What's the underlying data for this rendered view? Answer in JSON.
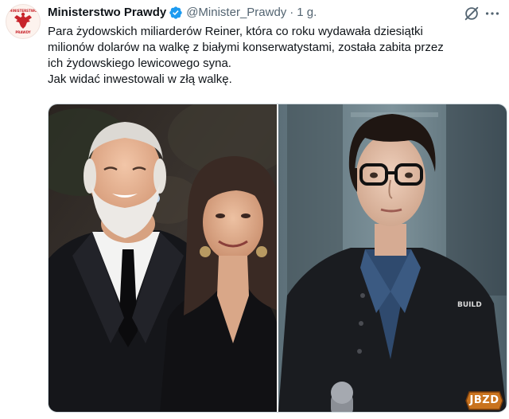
{
  "tweet": {
    "author": {
      "display_name": "Ministerstwo Prawdy",
      "handle": "@Minister_Prawdy",
      "separator": "·",
      "time": "1 g.",
      "verified": true,
      "avatar_logo_text": "MINISTERSTWO PRAWDY"
    },
    "text_lines": [
      "Para żydowskich miliarderów Reiner, która co roku wydawała dziesiątki",
      "milionów dolarów na walkę z białymi konserwatystami, została zabita przez",
      "ich żydowskiego lewicowego syna.",
      "Jak widać inwestowali w złą walkę."
    ],
    "media": {
      "count": 2,
      "jacket_logo_text": "BUILD"
    },
    "icons": {
      "verified": "verified-badge-icon",
      "grok": "grok-icon",
      "more": "more-options-icon"
    },
    "colors": {
      "verified": "#1d9bf0",
      "secondary_text": "#536471",
      "primary_text": "#0f1419",
      "avatar_red": "#c8242b"
    }
  },
  "watermark": {
    "text": "JBZD"
  }
}
